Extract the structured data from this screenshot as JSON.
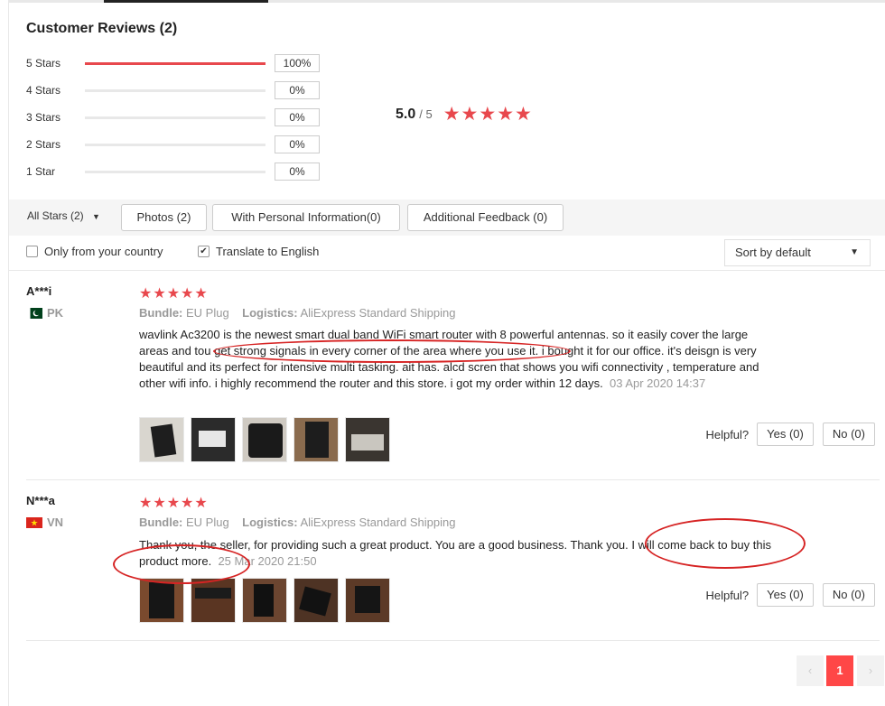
{
  "section_title": "Customer Reviews (2)",
  "histogram": [
    {
      "label": "5 Stars",
      "pct": "100%",
      "fill": 1.0
    },
    {
      "label": "4 Stars",
      "pct": "0%",
      "fill": 0
    },
    {
      "label": "3 Stars",
      "pct": "0%",
      "fill": 0
    },
    {
      "label": "2 Stars",
      "pct": "0%",
      "fill": 0
    },
    {
      "label": "1 Star",
      "pct": "0%",
      "fill": 0
    }
  ],
  "average": {
    "value": "5.0",
    "out_of": "/ 5",
    "stars": "★★★★★"
  },
  "filters": {
    "all_stars": "All Stars (2)",
    "photos": "Photos (2)",
    "personal": "With Personal Information(0)",
    "additional": "Additional Feedback (0)"
  },
  "options": {
    "only_country": "Only from your country",
    "translate": "Translate to English",
    "sort": "Sort by default"
  },
  "reviews": [
    {
      "name": "A***i",
      "country": "PK",
      "stars": "★★★★★",
      "bundle_label": "Bundle:",
      "bundle": "EU Plug",
      "logistics_label": "Logistics:",
      "logistics": "AliExpress Standard Shipping",
      "text": "wavlink Ac3200 is the newest smart dual band WiFi smart router with 8 powerful antennas. so it easily cover the large areas and tou get strong signals in every corner of the area where you use it. i bought it for our office. it's deisgn is very beautiful and its perfect for intensive multi tasking. ait has. alcd scren that shows you wifi connectivity , temperature and other wifi info. i highly recommend the router and this store. i got my order within 12 days.",
      "date": "03 Apr 2020 14:37",
      "helpful": "Helpful?",
      "yes": "Yes (0)",
      "no": "No (0)"
    },
    {
      "name": "N***a",
      "country": "VN",
      "stars": "★★★★★",
      "bundle_label": "Bundle:",
      "bundle": "EU Plug",
      "logistics_label": "Logistics:",
      "logistics": "AliExpress Standard Shipping",
      "text": "Thank you, the seller, for providing such a great product. You are a good business. Thank you. I will come back to buy this product more.",
      "date": "25 Mar 2020 21:50",
      "helpful": "Helpful?",
      "yes": "Yes (0)",
      "no": "No (0)"
    }
  ],
  "pagination": {
    "prev": "‹",
    "current": "1",
    "next": "›"
  },
  "colors": {
    "accent": "#e8484d",
    "annotation": "#d62424"
  },
  "icons": {
    "dropdown": "chevron-down-icon",
    "prev": "chevron-left-icon",
    "next": "chevron-right-icon"
  }
}
